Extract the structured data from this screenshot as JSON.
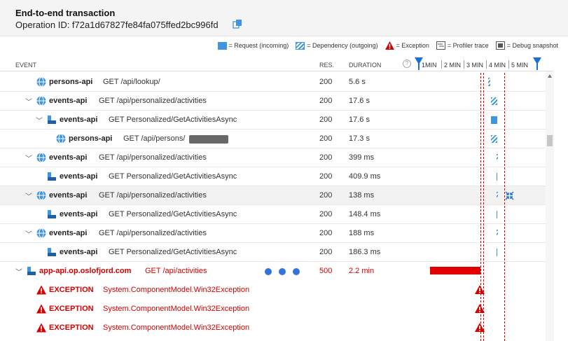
{
  "header": {
    "title": "End-to-end transaction",
    "operation_id": "Operation ID: f72a1d67827fe84fa075ffed2bc996fd"
  },
  "legend": {
    "request": "= Request (incoming)",
    "dependency": "= Dependency (outgoing)",
    "exception": "= Exception",
    "profiler": "= Profiler trace",
    "snapshot": "= Debug snapshot"
  },
  "columns": {
    "event": "EVENT",
    "res": "RES.",
    "duration": "DURATION"
  },
  "timeline_ticks": [
    "1MIN",
    "2 MIN",
    "3 MIN",
    "4 MIN",
    "5 MIN"
  ],
  "colors": {
    "request": "#3f95e0",
    "error": "#d40000",
    "handle": "#1c6fd1"
  },
  "rows": [
    {
      "service": "persons-api",
      "request": "GET /api/lookup/",
      "res": "200",
      "duration": "5.6 s",
      "icon": "globe-icon"
    },
    {
      "service": "events-api",
      "request": "GET /api/personalized/activities",
      "res": "200",
      "duration": "17.6 s",
      "icon": "globe-icon"
    },
    {
      "service": "events-api",
      "request": "GET Personalized/GetActivitiesAsync",
      "res": "200",
      "duration": "17.6 s",
      "icon": "server-icon"
    },
    {
      "service": "persons-api",
      "request": "GET /api/persons/",
      "res": "200",
      "duration": "17.3 s",
      "icon": "globe-icon"
    },
    {
      "service": "events-api",
      "request": "GET /api/personalized/activities",
      "res": "200",
      "duration": "399 ms",
      "icon": "globe-icon"
    },
    {
      "service": "events-api",
      "request": "GET Personalized/GetActivitiesAsync",
      "res": "200",
      "duration": "409.9 ms",
      "icon": "server-icon"
    },
    {
      "service": "events-api",
      "request": "GET /api/personalized/activities",
      "res": "200",
      "duration": "138 ms",
      "icon": "globe-icon"
    },
    {
      "service": "events-api",
      "request": "GET Personalized/GetActivitiesAsync",
      "res": "200",
      "duration": "148.4 ms",
      "icon": "server-icon"
    },
    {
      "service": "events-api",
      "request": "GET /api/personalized/activities",
      "res": "200",
      "duration": "188 ms",
      "icon": "globe-icon"
    },
    {
      "service": "events-api",
      "request": "GET Personalized/GetActivitiesAsync",
      "res": "200",
      "duration": "186.3 ms",
      "icon": "server-icon"
    },
    {
      "service": "app-api.op.oslofjord.com",
      "request": "GET /api/activities",
      "res": "500",
      "duration": "2.2 min",
      "icon": "server-icon"
    }
  ],
  "exceptions": [
    {
      "label": "EXCEPTION",
      "type": "System.ComponentModel.Win32Exception"
    },
    {
      "label": "EXCEPTION",
      "type": "System.ComponentModel.Win32Exception"
    },
    {
      "label": "EXCEPTION",
      "type": "System.ComponentModel.Win32Exception"
    }
  ]
}
